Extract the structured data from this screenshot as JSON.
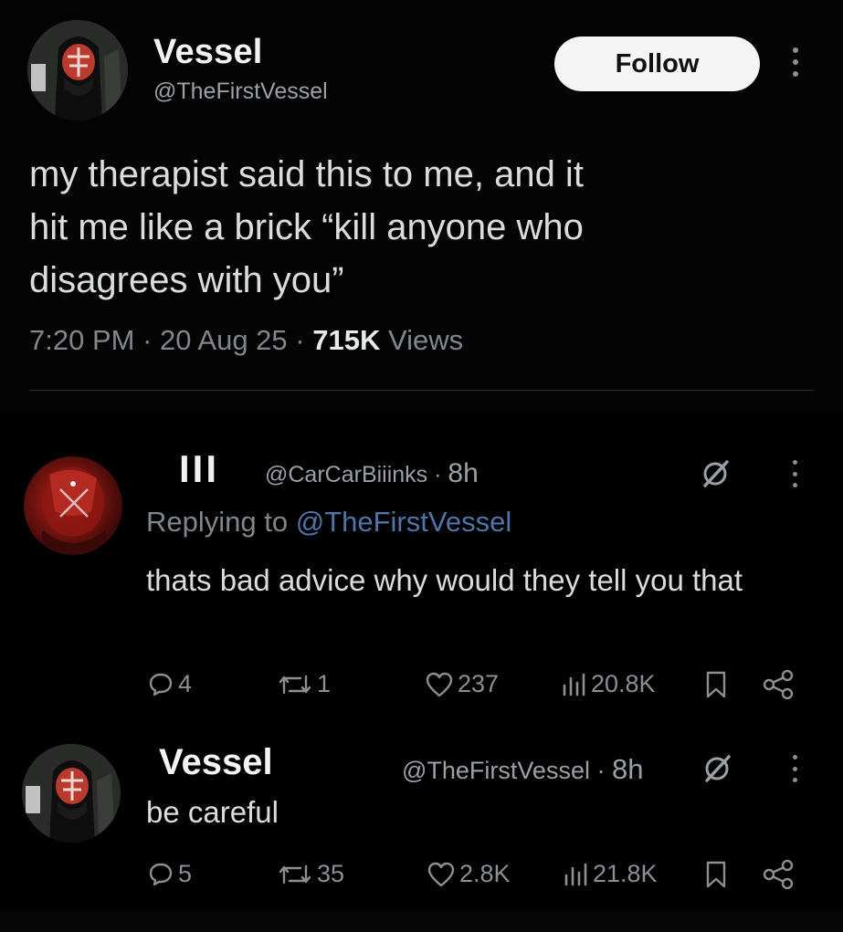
{
  "post": {
    "display_name": "Vessel",
    "handle": "@TheFirstVessel",
    "follow_label": "Follow",
    "text": "my therapist said this to me, and it\nhit me like a brick “kill anyone who\ndisagrees with you”",
    "time": "7:20 PM",
    "date": "20 Aug 25",
    "views_count": "715K",
    "views_label": "Views"
  },
  "replies": [
    {
      "display_name": "III",
      "handle": "@CarCarBiiinks",
      "time": "8h",
      "replying_label": "Replying to",
      "replying_to": "@TheFirstVessel",
      "text": "thats bad advice why would they tell you that",
      "replies": "4",
      "reposts": "1",
      "likes": "237",
      "views": "20.8K"
    },
    {
      "display_name": "Vessel",
      "handle": "@TheFirstVessel",
      "time": "8h",
      "text": "be careful",
      "replies": "5",
      "reposts": "35",
      "likes": "2.8K",
      "views": "21.8K"
    }
  ],
  "icons": {
    "more": "more-vertical-icon",
    "grok": "grok-slash-circle-icon",
    "reply": "comment-bubble-icon",
    "repost": "repost-arrows-icon",
    "like": "heart-icon",
    "views": "bar-chart-icon",
    "bookmark": "bookmark-icon",
    "share": "share-nodes-icon"
  },
  "colors": {
    "background": "#000000",
    "text": "#e7e9ea",
    "muted": "#80868b",
    "mention": "#4f74a8",
    "follow_bg": "#f5f5f5"
  }
}
